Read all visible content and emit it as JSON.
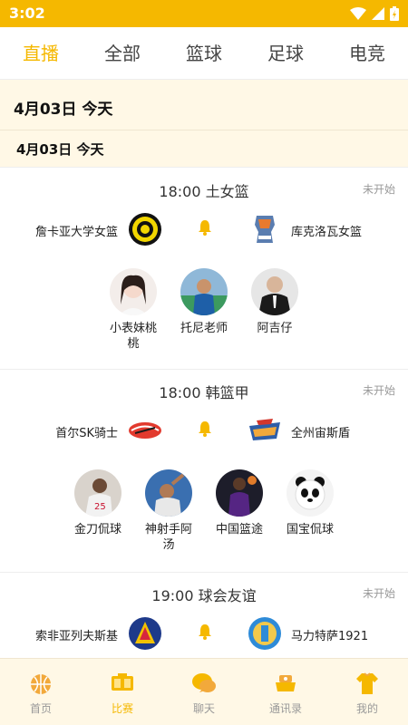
{
  "status_bar": {
    "time": "3:02"
  },
  "tabs": [
    {
      "label": "直播",
      "active": true
    },
    {
      "label": "全部",
      "active": false
    },
    {
      "label": "篮球",
      "active": false
    },
    {
      "label": "足球",
      "active": false
    },
    {
      "label": "电竞",
      "active": false
    }
  ],
  "date_banner": {
    "main": "4月03日  今天",
    "sub": "4月03日    今天"
  },
  "matches": [
    {
      "time_league": "18:00  土女篮",
      "status": "未开始",
      "home": "詹卡亚大学女篮",
      "away": "库克洛瓦女篮",
      "anchors": [
        "小表妹桃桃",
        "托尼老师",
        "阿吉仔"
      ]
    },
    {
      "time_league": "18:00  韩篮甲",
      "status": "未开始",
      "home": "首尔SK骑士",
      "away": "全州宙斯盾",
      "anchors": [
        "金刀侃球",
        "神射手阿汤",
        "中国篮途",
        "国宝侃球"
      ]
    },
    {
      "time_league": "19:00  球会友谊",
      "status": "未开始",
      "home": "索非亚列夫斯基",
      "away": "马力特萨1921",
      "anchors": []
    }
  ],
  "bottom_nav": [
    {
      "label": "首页",
      "icon": "home-basketball-icon",
      "active": false
    },
    {
      "label": "比赛",
      "icon": "scoreboard-icon",
      "active": true
    },
    {
      "label": "聊天",
      "icon": "chat-bubble-icon",
      "active": false
    },
    {
      "label": "通讯录",
      "icon": "contacts-icon",
      "active": false
    },
    {
      "label": "我的",
      "icon": "jersey-icon",
      "active": false
    }
  ],
  "colors": {
    "accent": "#F5B800",
    "banner_bg": "#FFF8E6",
    "muted": "#999999"
  }
}
